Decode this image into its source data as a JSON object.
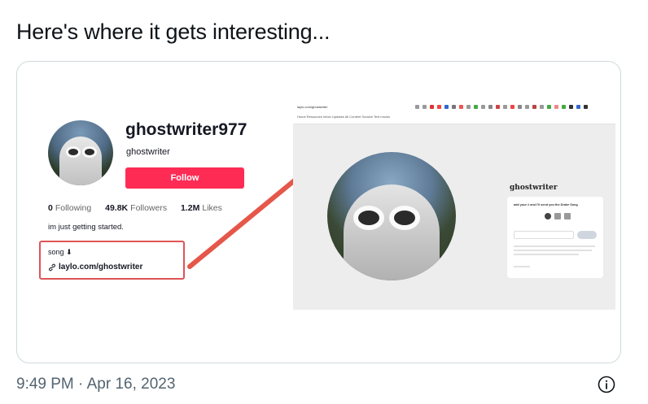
{
  "tweet": {
    "text": "Here's where it gets interesting...",
    "timestamp": "9:49 PM · Apr 16, 2023"
  },
  "profile": {
    "username": "ghostwriter977",
    "nickname": "ghostwriter",
    "follow_label": "Follow",
    "following_count": "0",
    "following_label": "Following",
    "followers_count": "49.8K",
    "followers_label": "Followers",
    "likes_count": "1.2M",
    "likes_label": "Likes",
    "bio": "im just getting started.",
    "song": "song ⬇",
    "link": "laylo.com/ghostwriter"
  },
  "browser": {
    "url": "laylo.com/ghostwriter",
    "bookmarks": "Home  Resources  Inbox  Updates  All Content  Scratch  Text mocks",
    "page_title": "ghostwriter",
    "card_text": "add your # and I'll send you the Drake Song"
  },
  "colors": {
    "follow": "#fe2c55",
    "highlight": "#e05454",
    "timestamp": "#536471"
  },
  "icons": [
    "link-icon",
    "info-icon",
    "arrow-annotation"
  ]
}
